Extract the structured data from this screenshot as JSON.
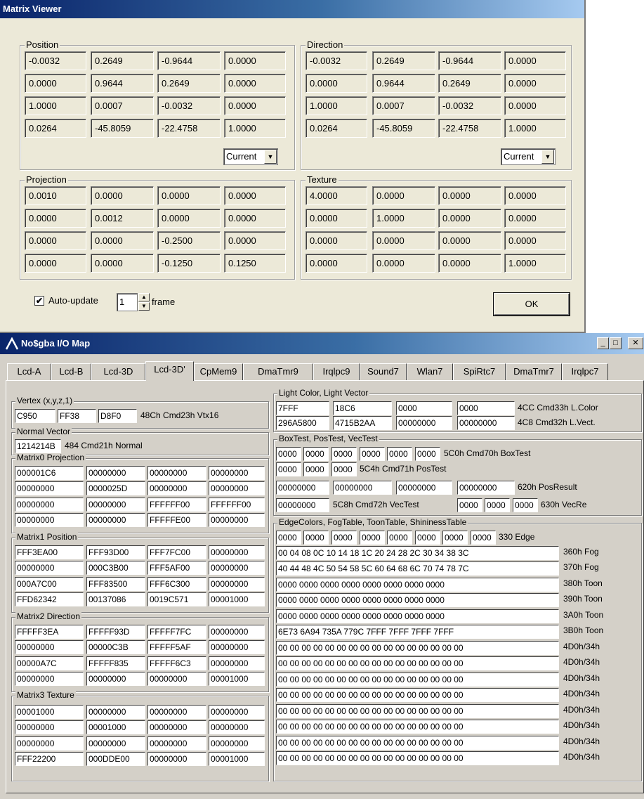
{
  "matrix_viewer": {
    "title": "Matrix Viewer",
    "groups": [
      {
        "title": "Position",
        "rows": [
          [
            "-0.0032",
            "0.2649",
            "-0.9644",
            "0.0000"
          ],
          [
            "0.0000",
            "0.9644",
            "0.2649",
            "0.0000"
          ],
          [
            "1.0000",
            "0.0007",
            "-0.0032",
            "0.0000"
          ],
          [
            "0.0264",
            "-45.8059",
            "-22.4758",
            "1.0000"
          ]
        ],
        "combo": "Current"
      },
      {
        "title": "Direction",
        "rows": [
          [
            "-0.0032",
            "0.2649",
            "-0.9644",
            "0.0000"
          ],
          [
            "0.0000",
            "0.9644",
            "0.2649",
            "0.0000"
          ],
          [
            "1.0000",
            "0.0007",
            "-0.0032",
            "0.0000"
          ],
          [
            "0.0264",
            "-45.8059",
            "-22.4758",
            "1.0000"
          ]
        ],
        "combo": "Current"
      },
      {
        "title": "Projection",
        "rows": [
          [
            "0.0010",
            "0.0000",
            "0.0000",
            "0.0000"
          ],
          [
            "0.0000",
            "0.0012",
            "0.0000",
            "0.0000"
          ],
          [
            "0.0000",
            "0.0000",
            "-0.2500",
            "0.0000"
          ],
          [
            "0.0000",
            "0.0000",
            "-0.1250",
            "0.1250"
          ]
        ]
      },
      {
        "title": "Texture",
        "rows": [
          [
            "4.0000",
            "0.0000",
            "0.0000",
            "0.0000"
          ],
          [
            "0.0000",
            "1.0000",
            "0.0000",
            "0.0000"
          ],
          [
            "0.0000",
            "0.0000",
            "0.0000",
            "0.0000"
          ],
          [
            "0.0000",
            "0.0000",
            "0.0000",
            "1.0000"
          ]
        ]
      }
    ],
    "auto_update_label": "Auto-update",
    "auto_update_checked": "✔",
    "frames_value": "1",
    "frames_label": "frame",
    "ok_label": "OK"
  },
  "io_map": {
    "title": "No$gba I/O Map",
    "title_buttons": {
      "minimize": "_",
      "maximize": "□",
      "close": "✕"
    },
    "tabs": [
      "Lcd-A",
      "Lcd-B",
      "Lcd-3D",
      "Lcd-3D'",
      "CpMem9",
      "DmaTmr9",
      "Irqlpc9",
      "Sound7",
      "Wlan7",
      "SpiRtc7",
      "DmaTmr7",
      "Irqlpc7"
    ],
    "vertex": {
      "title": "Vertex (x,y,z,1)",
      "cells": [
        "C950",
        "FF38",
        "D8F0"
      ],
      "label": "48Ch Cmd23h Vtx16"
    },
    "normal": {
      "title": "Normal Vector",
      "cells": [
        "1214214B"
      ],
      "label": "484 Cmd21h Normal"
    },
    "matrices": [
      {
        "title": "Matrix0 Projection",
        "rows": [
          [
            "000001C6",
            "00000000",
            "00000000",
            "00000000"
          ],
          [
            "00000000",
            "0000025D",
            "00000000",
            "00000000"
          ],
          [
            "00000000",
            "00000000",
            "FFFFFF00",
            "FFFFFF00"
          ],
          [
            "00000000",
            "00000000",
            "FFFFFE00",
            "00000000"
          ]
        ]
      },
      {
        "title": "Matrix1 Position",
        "rows": [
          [
            "FFF3EA00",
            "FFF93D00",
            "FFF7FC00",
            "00000000"
          ],
          [
            "00000000",
            "000C3B00",
            "FFF5AF00",
            "00000000"
          ],
          [
            "000A7C00",
            "FFF83500",
            "FFF6C300",
            "00000000"
          ],
          [
            "FFD62342",
            "00137086",
            "0019C571",
            "00001000"
          ]
        ]
      },
      {
        "title": "Matrix2 Direction",
        "rows": [
          [
            "FFFFF3EA",
            "FFFFF93D",
            "FFFFF7FC",
            "00000000"
          ],
          [
            "00000000",
            "00000C3B",
            "FFFFF5AF",
            "00000000"
          ],
          [
            "00000A7C",
            "FFFFF835",
            "FFFFF6C3",
            "00000000"
          ],
          [
            "00000000",
            "00000000",
            "00000000",
            "00001000"
          ]
        ]
      },
      {
        "title": "Matrix3 Texture",
        "rows": [
          [
            "00001000",
            "00000000",
            "00000000",
            "00000000"
          ],
          [
            "00000000",
            "00001000",
            "00000000",
            "00000000"
          ],
          [
            "00000000",
            "00000000",
            "00000000",
            "00000000"
          ],
          [
            "FFF22200",
            "000DDE00",
            "00000000",
            "00001000"
          ]
        ]
      }
    ],
    "light": {
      "title": "Light Color, Light Vector",
      "row1": {
        "cells": [
          "7FFF",
          "18C6",
          "0000",
          "0000"
        ],
        "label": "4CC Cmd33h L.Color"
      },
      "row2": {
        "cells": [
          "296A5800",
          "4715B2AA",
          "00000000",
          "00000000"
        ],
        "label": "4C8 Cmd32h L.Vect."
      }
    },
    "boxtest": {
      "title": "BoxTest, PosTest, VecTest",
      "row1": {
        "cells": [
          "0000",
          "0000",
          "0000",
          "0000",
          "0000",
          "0000"
        ],
        "label": "5C0h Cmd70h BoxTest"
      },
      "row2": {
        "cells": [
          "0000",
          "0000",
          "0000"
        ],
        "label": "5C4h Cmd71h PosTest"
      },
      "row3": {
        "cells": [
          "00000000",
          "00000000",
          "00000000",
          "00000000"
        ],
        "label": "620h PosResult"
      },
      "row4": {
        "cell": "00000000",
        "label": "5C8h Cmd72h VecTest",
        "cells2": [
          "0000",
          "0000",
          "0000"
        ],
        "label2": "630h VecRe"
      }
    },
    "edge": {
      "title": "EdgeColors, FogTable, ToonTable, ShininessTable",
      "row1": {
        "cells": [
          "0000",
          "0000",
          "0000",
          "0000",
          "0000",
          "0000",
          "0000",
          "0000"
        ],
        "label": "330 Edge"
      },
      "rows": [
        {
          "value": "00 04 08 0C 10 14 18 1C 20 24 28 2C 30 34 38 3C",
          "label": "360h Fog"
        },
        {
          "value": "40 44 48 4C 50 54 58 5C 60 64 68 6C 70 74 78 7C",
          "label": "370h Fog"
        },
        {
          "value": "0000 0000 0000 0000 0000 0000 0000 0000",
          "label": "380h Toon"
        },
        {
          "value": "0000 0000 0000 0000 0000 0000 0000 0000",
          "label": "390h Toon"
        },
        {
          "value": "0000 0000 0000 0000 0000 0000 0000 0000",
          "label": "3A0h Toon"
        },
        {
          "value": "6E73 6A94 735A 779C 7FFF 7FFF 7FFF 7FFF",
          "label": "3B0h Toon"
        },
        {
          "value": "00 00 00 00 00 00 00 00 00 00 00 00 00 00 00 00",
          "label": "4D0h/34h"
        },
        {
          "value": "00 00 00 00 00 00 00 00 00 00 00 00 00 00 00 00",
          "label": "4D0h/34h"
        },
        {
          "value": "00 00 00 00 00 00 00 00 00 00 00 00 00 00 00 00",
          "label": "4D0h/34h"
        },
        {
          "value": "00 00 00 00 00 00 00 00 00 00 00 00 00 00 00 00",
          "label": "4D0h/34h"
        },
        {
          "value": "00 00 00 00 00 00 00 00 00 00 00 00 00 00 00 00",
          "label": "4D0h/34h"
        },
        {
          "value": "00 00 00 00 00 00 00 00 00 00 00 00 00 00 00 00",
          "label": "4D0h/34h"
        },
        {
          "value": "00 00 00 00 00 00 00 00 00 00 00 00 00 00 00 00",
          "label": "4D0h/34h"
        },
        {
          "value": "00 00 00 00 00 00 00 00 00 00 00 00 00 00 00 00",
          "label": "4D0h/34h"
        }
      ]
    }
  }
}
